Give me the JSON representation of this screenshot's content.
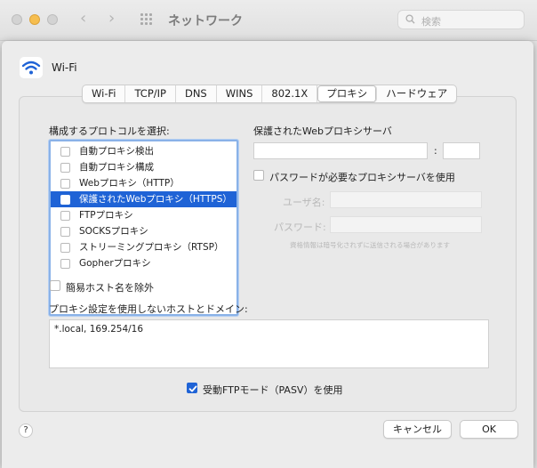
{
  "window": {
    "title": "ネットワーク",
    "search_placeholder": "検索"
  },
  "interface": {
    "name": "Wi-Fi",
    "icon": "wifi-icon"
  },
  "tabs": [
    {
      "label": "Wi-Fi",
      "active": false
    },
    {
      "label": "TCP/IP",
      "active": false
    },
    {
      "label": "DNS",
      "active": false
    },
    {
      "label": "WINS",
      "active": false
    },
    {
      "label": "802.1X",
      "active": false
    },
    {
      "label": "プロキシ",
      "active": true
    },
    {
      "label": "ハードウェア",
      "active": false
    }
  ],
  "protocols": {
    "heading": "構成するプロトコルを選択:",
    "items": [
      {
        "label": "自動プロキシ検出",
        "checked": false,
        "selected": false
      },
      {
        "label": "自動プロキシ構成",
        "checked": false,
        "selected": false
      },
      {
        "label": "Webプロキシ（HTTP）",
        "checked": false,
        "selected": false
      },
      {
        "label": "保護されたWebプロキシ（HTTPS）",
        "checked": false,
        "selected": true
      },
      {
        "label": "FTPプロキシ",
        "checked": false,
        "selected": false
      },
      {
        "label": "SOCKSプロキシ",
        "checked": false,
        "selected": false
      },
      {
        "label": "ストリーミングプロキシ（RTSP）",
        "checked": false,
        "selected": false
      },
      {
        "label": "Gopherプロキシ",
        "checked": false,
        "selected": false
      }
    ]
  },
  "proxy_server": {
    "heading": "保護されたWebプロキシサーバ",
    "colon": ":",
    "server_value": "",
    "port_value": "",
    "password_required_label": "パスワードが必要なプロキシサーバを使用",
    "username_label": "ユーザ名:",
    "password_label": "パスワード:",
    "note": "資格情報は暗号化されずに送信される場合があります"
  },
  "exclude_simple_hostnames": {
    "label": "簡易ホスト名を除外",
    "checked": false
  },
  "bypass": {
    "heading": "プロキシ設定を使用しないホストとドメイン:",
    "value": "*.local, 169.254/16"
  },
  "passive_ftp": {
    "label": "受動FTPモード（PASV）を使用",
    "checked": true
  },
  "buttons": {
    "help": "?",
    "cancel": "キャンセル",
    "ok": "OK"
  },
  "colors": {
    "accent": "#1f63d6",
    "focus_ring": "#8ab2e8"
  }
}
